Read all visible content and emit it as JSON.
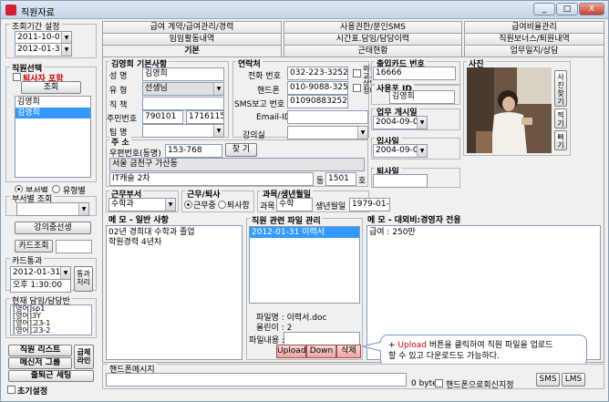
{
  "window": {
    "title": "직원자료",
    "min": "_",
    "max": "□",
    "close": "X"
  },
  "left": {
    "period_label": "조회기간 설정",
    "date_from": "2011-10-01",
    "date_to": "2012-01-31",
    "staff_select_label": "직원선택",
    "retired_include": "퇴사자 포함",
    "search_button": "조회",
    "staff_list": [
      "김영희",
      "김영희"
    ],
    "dept_radio": "부서별",
    "type_radio": "유형별",
    "dept_search_label": "부서별 조회",
    "lecture_button": "강의중선생",
    "card_search_button": "카드조회",
    "card_pass_label": "카드통과",
    "card_date": "2012-01-31",
    "card_time": "오후 1:30:00",
    "pass_button": "통과처리",
    "current_staff_label": "현재 담임/담당반",
    "current_classes": [
      "[영어]sp1",
      "[영어]3Y",
      "[영어]고3-1",
      "[영어]고3-2"
    ],
    "staff_list_button": "직원 리스트",
    "messenger_button": "메신저 그룹",
    "print_button": "급체라인",
    "commute_button": "출퇴근 세팅",
    "init_label": "초기설정"
  },
  "tabs_row1": [
    "급여 계약/급여관리/경력",
    "사용권한/분인SMS",
    "급여비율관리"
  ],
  "tabs_row2": [
    "임임활동내역",
    "시간표.담임/담당이력",
    "직원보너스/퇴원내역"
  ],
  "tabs_row3": [
    "기본",
    "근태현황",
    "업무일지/상담"
  ],
  "basic": {
    "group_label": "김영희 기본사항",
    "name_label": "성   명",
    "name_value": "김영희",
    "type_label": "유   형",
    "type_value": "선생님",
    "position_label": "직   책",
    "ssn_label": "주민번호",
    "ssn1": "790101",
    "ssn2": "1716115",
    "team_label": "팀   명"
  },
  "contact": {
    "group_label": "연락처",
    "phone_label": "전화 번호",
    "phone_value": "032-223-3252",
    "mobile_label": "핸드폰",
    "mobile_value": "010-9088-3252",
    "sms_label": "SMS보고 번호",
    "sms_value": "01090883252",
    "email_label": "Email-ID",
    "outside_label": "외국인",
    "outside_label2": "교사",
    "counsel_label": "상담요",
    "counsel_label2": "청대상",
    "room_label": "강의실"
  },
  "card": {
    "label": "출입카드 번호",
    "value": "16666",
    "user_id_label": "사용포 ID",
    "user_id_value": "김영희"
  },
  "photo_label": "사진",
  "photo_buttons": [
    "사진찾기",
    "찍기",
    "삐기"
  ],
  "work_start_label": "업무 개시일",
  "work_start_value": "2004-09-01",
  "hire_label": "입사일",
  "hire_value": "2004-09-01",
  "leave_label": "퇴사일",
  "address": {
    "label": "주  소",
    "zip_label": "우편번호(동명)",
    "zip_value": "153-768",
    "search_button": "찾 기",
    "addr1": "서울 금천구 가산동",
    "addr2": "IT캐슬 2차",
    "dong_label": "동",
    "ho_value": "1501",
    "ho_label": "호"
  },
  "dept": {
    "label": "근무부서",
    "value": "수학과",
    "status_label": "근무/퇴사",
    "working": "근무중",
    "retired": "퇴사함",
    "subject_label": "과목/생년월일",
    "subject_field": "과목",
    "subject_value": "수학",
    "birth_label": "생년월일",
    "birth_value": "1979-01-0"
  },
  "memo": {
    "label": "메  모 - 일반 사항",
    "lines": [
      "02년 경희대 수학과 졸업",
      "학원경력 4년차"
    ]
  },
  "files": {
    "label": "직원 관련 파일 관리",
    "items": [
      "2012-01-31 이력서"
    ],
    "file_name_label": "파일명 : 이력서.doc",
    "uploader_label": "올린이 : 2",
    "content_label": "파일내용 :",
    "upload": "Upload",
    "down": "Down",
    "delete": "삭제"
  },
  "memo2": {
    "label": "메  모 - 대외비:경영자 전용",
    "lines": [
      "급여 : 250만"
    ]
  },
  "tooltip": {
    "prefix": "+ ",
    "highlight": "Upload",
    "line1": " 버튼을 클릭하여 직원 파일을 업로드",
    "line2": "할 수 있고 다운로드도 가능하다."
  },
  "bottom": {
    "phone_msg_label": "핸드폰메시지",
    "byte_label": "0 byte",
    "auto_send": "핸드폰으로회신지정",
    "sms_button": "SMS",
    "lms_button": "LMS"
  },
  "colors": {
    "selection": "#3399ff",
    "red_text": "#cc0000",
    "tooltip_border": "#7a96c8"
  }
}
